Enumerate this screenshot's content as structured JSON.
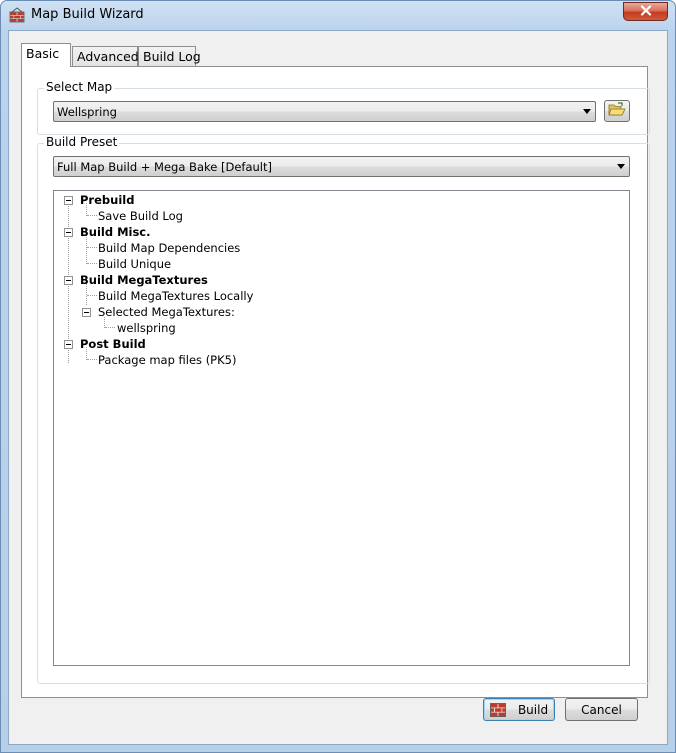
{
  "window": {
    "title": "Map Build Wizard"
  },
  "tabs": [
    {
      "label": "Basic",
      "active": true
    },
    {
      "label": "Advanced",
      "active": false
    },
    {
      "label": "Build Log",
      "active": false
    }
  ],
  "select_map": {
    "label": "Select Map",
    "value": "Wellspring"
  },
  "build_preset": {
    "label": "Build Preset",
    "value": "Full Map Build + Mega Bake [Default]"
  },
  "tree": {
    "items": [
      {
        "label": "Prebuild",
        "bold": true,
        "level": 0
      },
      {
        "label": "Save Build Log",
        "bold": false,
        "level": 1
      },
      {
        "label": "Build Misc.",
        "bold": true,
        "level": 0
      },
      {
        "label": "Build Map Dependencies",
        "bold": false,
        "level": 1
      },
      {
        "label": "Build Unique",
        "bold": false,
        "level": 1
      },
      {
        "label": "Build MegaTextures",
        "bold": true,
        "level": 0
      },
      {
        "label": "Build MegaTextures Locally",
        "bold": false,
        "level": 1
      },
      {
        "label": "Selected MegaTextures:",
        "bold": false,
        "level": 1
      },
      {
        "label": "wellspring",
        "bold": false,
        "level": 2
      },
      {
        "label": "Post Build",
        "bold": true,
        "level": 0
      },
      {
        "label": "Package map files (PK5)",
        "bold": false,
        "level": 1
      }
    ]
  },
  "buttons": {
    "build": "Build",
    "cancel": "Cancel"
  },
  "icons": {
    "app": "brick-wall-icon",
    "browse": "open-folder-icon",
    "build": "brick-wall-icon",
    "close": "close-icon"
  },
  "colors": {
    "close_button": "#c43b1f",
    "title_bar": "#bcd3ec"
  }
}
